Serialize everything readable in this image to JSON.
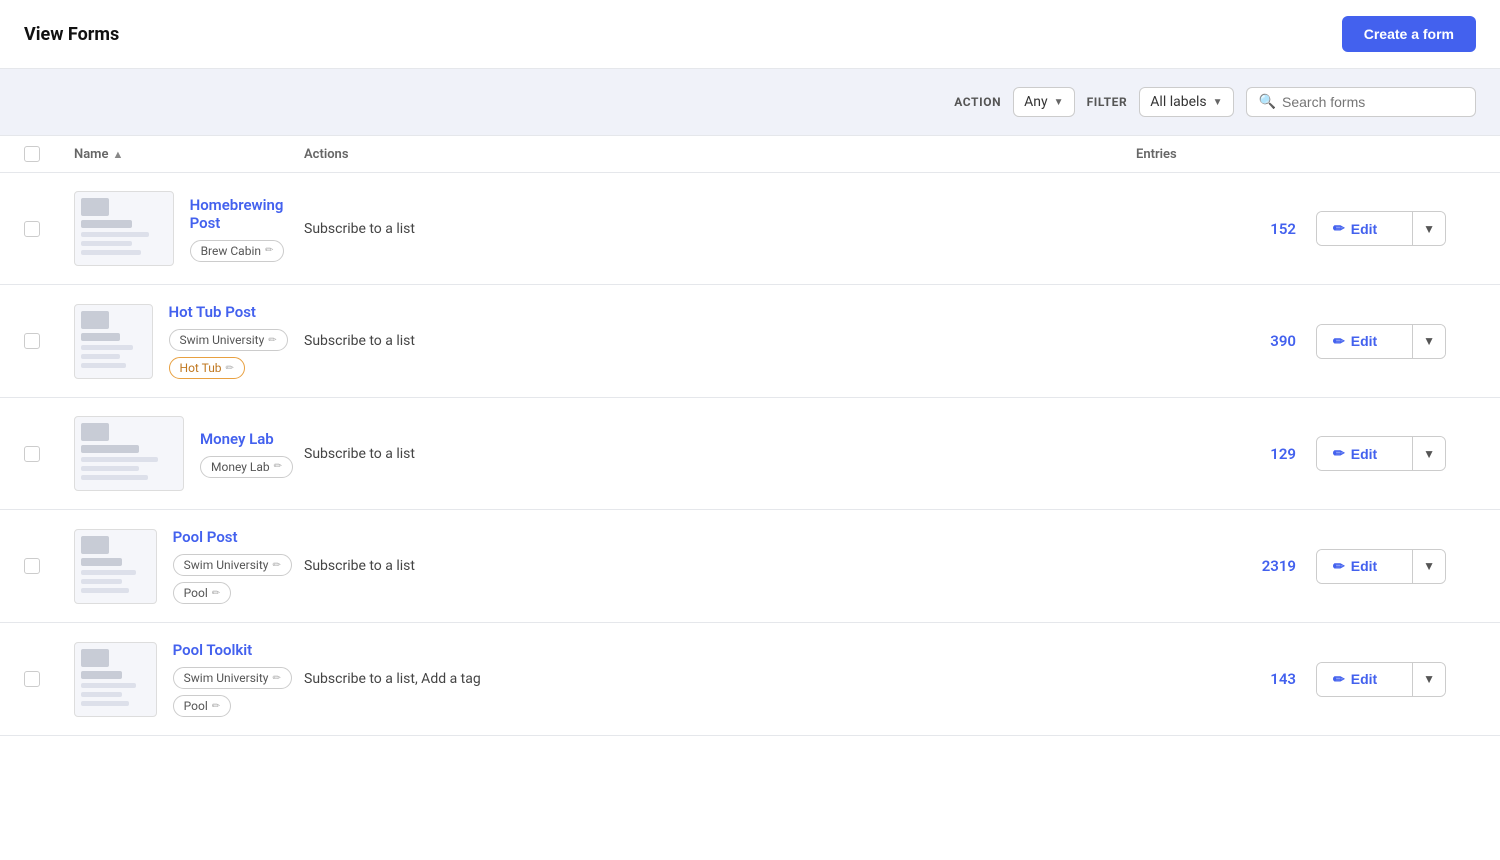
{
  "header": {
    "title": "View Forms",
    "create_button_label": "Create a form"
  },
  "toolbar": {
    "action_label": "ACTION",
    "action_value": "Any",
    "filter_label": "FILTER",
    "filter_value": "All labels",
    "search_placeholder": "Search forms"
  },
  "table": {
    "columns": {
      "name": "Name",
      "actions": "Actions",
      "entries": "Entries"
    },
    "rows": [
      {
        "id": "row-1",
        "title": "Homebrewing Post",
        "tags": [
          {
            "label": "Brew Cabin",
            "style": "default"
          }
        ],
        "action": "Subscribe to a list",
        "entries": "152"
      },
      {
        "id": "row-2",
        "title": "Hot Tub Post",
        "tags": [
          {
            "label": "Swim University",
            "style": "default"
          },
          {
            "label": "Hot Tub",
            "style": "orange"
          }
        ],
        "action": "Subscribe to a list",
        "entries": "390"
      },
      {
        "id": "row-3",
        "title": "Money Lab",
        "tags": [
          {
            "label": "Money Lab",
            "style": "default"
          }
        ],
        "action": "Subscribe to a list",
        "entries": "129"
      },
      {
        "id": "row-4",
        "title": "Pool Post",
        "tags": [
          {
            "label": "Swim University",
            "style": "default"
          },
          {
            "label": "Pool",
            "style": "default"
          }
        ],
        "action": "Subscribe to a list",
        "entries": "2319"
      },
      {
        "id": "row-5",
        "title": "Pool Toolkit",
        "tags": [
          {
            "label": "Swim University",
            "style": "default"
          },
          {
            "label": "Pool",
            "style": "default"
          }
        ],
        "action": "Subscribe to a list, Add a tag",
        "entries": "143"
      }
    ]
  },
  "edit_label": "Edit",
  "icons": {
    "search": "🔍",
    "pencil": "✏️",
    "chevron_down": "▼",
    "sort_asc": "▲"
  }
}
